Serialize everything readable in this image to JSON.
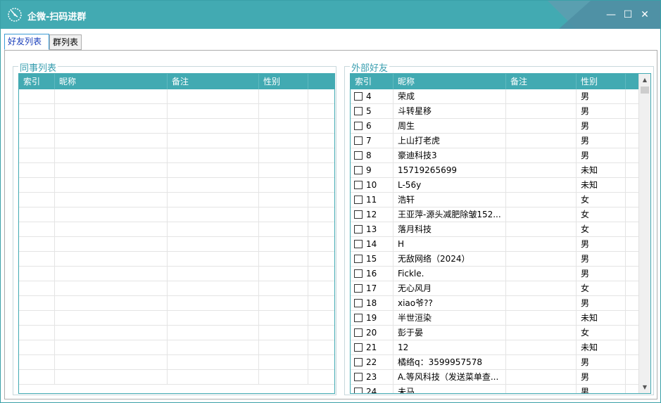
{
  "window": {
    "title": "企微-扫码进群",
    "controls": {
      "minimize": "—",
      "maximize": "☐",
      "close": "✕"
    }
  },
  "tabs": [
    {
      "label": "好友列表",
      "active": true
    },
    {
      "label": "群列表",
      "active": false
    }
  ],
  "colleagues": {
    "title": "同事列表",
    "columns": [
      "索引",
      "昵称",
      "备注",
      "性别"
    ]
  },
  "external": {
    "title": "外部好友",
    "columns": [
      "索引",
      "昵称",
      "备注",
      "性别"
    ],
    "rows": [
      {
        "index": "4",
        "nickname": "荣成",
        "note": "",
        "gender": "男"
      },
      {
        "index": "5",
        "nickname": "斗转星移",
        "note": "",
        "gender": "男"
      },
      {
        "index": "6",
        "nickname": "周生",
        "note": "",
        "gender": "男"
      },
      {
        "index": "7",
        "nickname": "上山打老虎",
        "note": "",
        "gender": "男"
      },
      {
        "index": "8",
        "nickname": "豪迪科技3",
        "note": "",
        "gender": "男"
      },
      {
        "index": "9",
        "nickname": "15719265699",
        "note": "",
        "gender": "未知"
      },
      {
        "index": "10",
        "nickname": "L-56y",
        "note": "",
        "gender": "未知"
      },
      {
        "index": "11",
        "nickname": "浩轩",
        "note": "",
        "gender": "女"
      },
      {
        "index": "12",
        "nickname": "王亚萍-源头减肥除皱152...",
        "note": "",
        "gender": "女"
      },
      {
        "index": "13",
        "nickname": "落月科技",
        "note": "",
        "gender": "女"
      },
      {
        "index": "14",
        "nickname": "H",
        "note": "",
        "gender": "男"
      },
      {
        "index": "15",
        "nickname": "无敌网络（2024）",
        "note": "",
        "gender": "男"
      },
      {
        "index": "16",
        "nickname": "Fickle.",
        "note": "",
        "gender": "男"
      },
      {
        "index": "17",
        "nickname": "无心风月",
        "note": "",
        "gender": "女"
      },
      {
        "index": "18",
        "nickname": "xiao爷??",
        "note": "",
        "gender": "男"
      },
      {
        "index": "19",
        "nickname": "半世洹染",
        "note": "",
        "gender": "未知"
      },
      {
        "index": "20",
        "nickname": "彭于晏",
        "note": "",
        "gender": "女"
      },
      {
        "index": "21",
        "nickname": "12",
        "note": "",
        "gender": "未知"
      },
      {
        "index": "22",
        "nickname": "橘络q：3599957578",
        "note": "",
        "gender": "男"
      },
      {
        "index": "23",
        "nickname": "A.等风科技（发送菜单查...",
        "note": "",
        "gender": "男"
      },
      {
        "index": "24",
        "nickname": "未马",
        "note": "",
        "gender": "男"
      }
    ]
  },
  "colors": {
    "accent": "#42aab2",
    "title_text": "#ffffff",
    "group_title": "#3a9fb0"
  },
  "icons": {
    "app": "clock-icon",
    "scroll_up": "scroll-up-arrow-icon",
    "scroll_down": "scroll-down-arrow-icon"
  }
}
